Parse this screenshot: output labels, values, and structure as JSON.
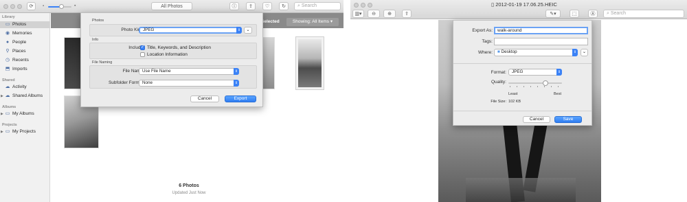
{
  "photos_window": {
    "toolbar": {
      "view_selector": "All Photos",
      "search_placeholder": "Search"
    },
    "sidebar": {
      "sections": [
        {
          "title": "Library",
          "items": [
            {
              "label": "Photos",
              "icon": "photos-icon",
              "selected": true
            },
            {
              "label": "Memories",
              "icon": "memories-icon"
            },
            {
              "label": "People",
              "icon": "people-icon"
            },
            {
              "label": "Places",
              "icon": "places-icon"
            },
            {
              "label": "Recents",
              "icon": "recents-icon"
            },
            {
              "label": "Imports",
              "icon": "imports-icon"
            }
          ]
        },
        {
          "title": "Shared",
          "items": [
            {
              "label": "Activity",
              "icon": "cloud-icon"
            },
            {
              "label": "Shared Albums",
              "icon": "shared-albums-icon"
            }
          ]
        },
        {
          "title": "Albums",
          "items": [
            {
              "label": "My Albums",
              "icon": "albums-icon"
            }
          ]
        },
        {
          "title": "Projects",
          "items": [
            {
              "label": "My Projects",
              "icon": "projects-icon"
            }
          ]
        }
      ]
    },
    "selection_bar": {
      "selected_text": "Selected",
      "showing_label": "Showing: All Items"
    },
    "export_dialog": {
      "photos_group": {
        "header": "Photos",
        "photo_kind_label": "Photo Kind:",
        "photo_kind_value": "JPEG"
      },
      "info_group": {
        "header": "Info",
        "include_label": "Include:",
        "options": [
          {
            "label": "Title, Keywords, and Description",
            "checked": true
          },
          {
            "label": "Location Information",
            "checked": false
          }
        ]
      },
      "naming_group": {
        "header": "File Naming",
        "file_name_label": "File Name:",
        "file_name_value": "Use File Name",
        "subfolder_label": "Subfolder Format:",
        "subfolder_value": "None"
      },
      "cancel_label": "Cancel",
      "export_label": "Export"
    },
    "footer": {
      "count": "6 Photos",
      "status": "Updated Just Now"
    }
  },
  "preview_window": {
    "title": "2012-01-19 17.06.25.HEIC",
    "search_placeholder": "Search",
    "export_sheet": {
      "export_as_label": "Export As:",
      "export_as_value": "walk-around",
      "tags_label": "Tags:",
      "tags_value": "",
      "where_label": "Where:",
      "where_value": "Desktop",
      "format_label": "Format:",
      "format_value": "JPEG",
      "quality_label": "Quality:",
      "quality_value": 0.72,
      "quality_min_label": "Least",
      "quality_max_label": "Best",
      "file_size_label": "File Size:",
      "file_size_value": "102 KB",
      "cancel_label": "Cancel",
      "save_label": "Save"
    }
  },
  "colors": {
    "accent": "#3b82f6",
    "sidebar_bg": "#f1f1f1",
    "dialog_bg": "#ececec"
  }
}
